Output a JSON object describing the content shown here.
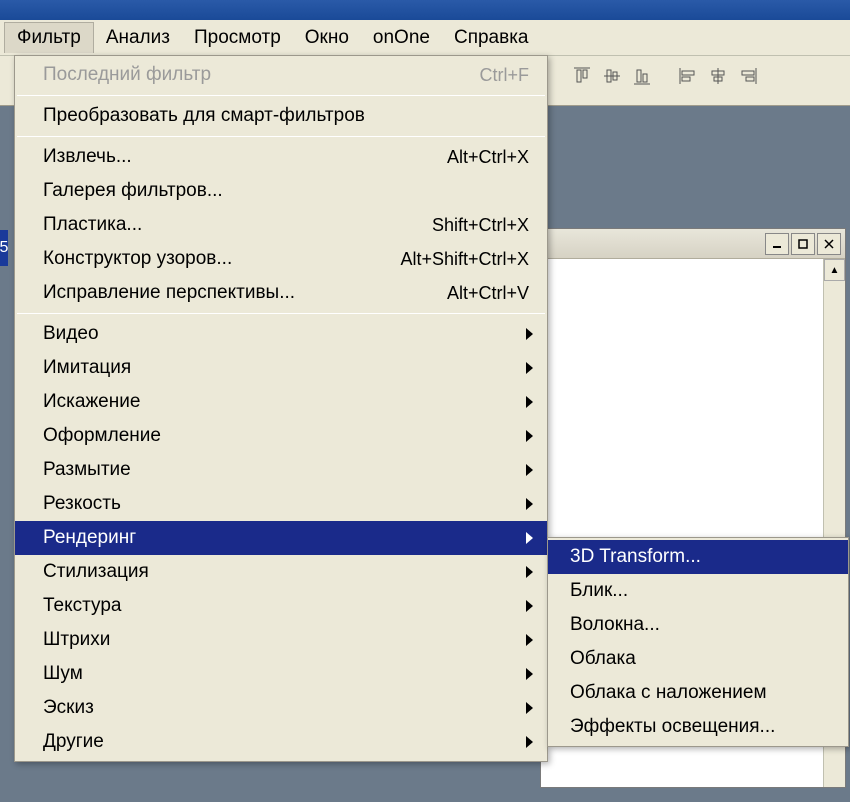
{
  "menubar": {
    "items": [
      {
        "label": "Фильтр"
      },
      {
        "label": "Анализ"
      },
      {
        "label": "Просмотр"
      },
      {
        "label": "Окно"
      },
      {
        "label": "onOne"
      },
      {
        "label": "Справка"
      }
    ]
  },
  "dropdown": {
    "sections": {
      "last": {
        "label": "Последний фильтр",
        "shortcut": "Ctrl+F"
      },
      "smart": {
        "label": "Преобразовать для смарт-фильтров"
      },
      "extract": {
        "label": "Извлечь...",
        "shortcut": "Alt+Ctrl+X"
      },
      "gallery": {
        "label": "Галерея фильтров..."
      },
      "plastic": {
        "label": "Пластика...",
        "shortcut": "Shift+Ctrl+X"
      },
      "pattern": {
        "label": "Конструктор узоров...",
        "shortcut": "Alt+Shift+Ctrl+X"
      },
      "vanish": {
        "label": "Исправление перспективы...",
        "shortcut": "Alt+Ctrl+V"
      },
      "video": {
        "label": "Видео"
      },
      "imitation": {
        "label": "Имитация"
      },
      "distort": {
        "label": "Искажение"
      },
      "style": {
        "label": "Оформление"
      },
      "blur": {
        "label": "Размытие"
      },
      "sharpen": {
        "label": "Резкость"
      },
      "render": {
        "label": "Рендеринг"
      },
      "stylize": {
        "label": "Стилизация"
      },
      "texture": {
        "label": "Текстура"
      },
      "strokes": {
        "label": "Штрихи"
      },
      "noise": {
        "label": "Шум"
      },
      "sketch": {
        "label": "Эскиз"
      },
      "other": {
        "label": "Другие"
      }
    }
  },
  "submenu": {
    "items": [
      {
        "label": "3D Transform..."
      },
      {
        "label": "Блик..."
      },
      {
        "label": "Волокна..."
      },
      {
        "label": "Облака"
      },
      {
        "label": "Облака с наложением"
      },
      {
        "label": "Эффекты освещения..."
      }
    ]
  },
  "left_edge_text": "5"
}
